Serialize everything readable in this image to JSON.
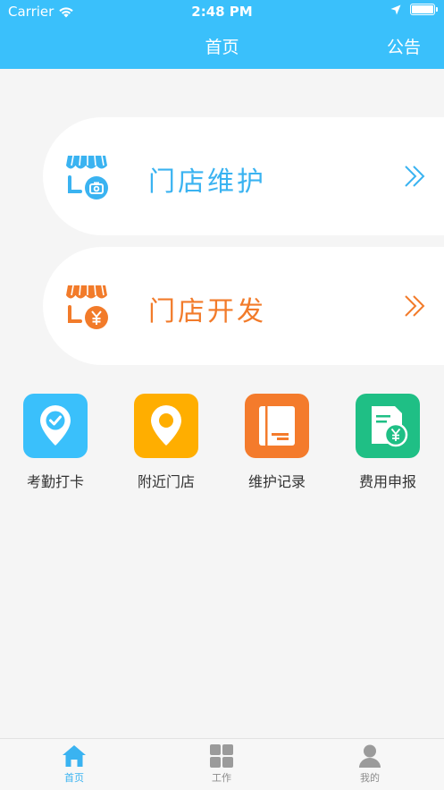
{
  "status_bar": {
    "carrier": "Carrier",
    "time": "2:48 PM"
  },
  "nav": {
    "title": "首页",
    "right_action": "公告"
  },
  "cards": [
    {
      "label": "门店维护",
      "color": "#3ab3f1"
    },
    {
      "label": "门店开发",
      "color": "#f27b2a"
    }
  ],
  "grid": [
    {
      "label": "考勤打卡",
      "color": "#3ac0fb",
      "icon": "checkin-pin-icon"
    },
    {
      "label": "附近门店",
      "color": "#ffae00",
      "icon": "location-pin-icon"
    },
    {
      "label": "维护记录",
      "color": "#f47b2c",
      "icon": "notebook-icon"
    },
    {
      "label": "费用申报",
      "color": "#1fbf85",
      "icon": "expense-document-icon"
    }
  ],
  "tabbar": [
    {
      "label": "首页",
      "active": true
    },
    {
      "label": "工作",
      "active": false
    },
    {
      "label": "我的",
      "active": false
    }
  ],
  "colors": {
    "header": "#3ac0fb",
    "background": "#f5f5f5"
  }
}
